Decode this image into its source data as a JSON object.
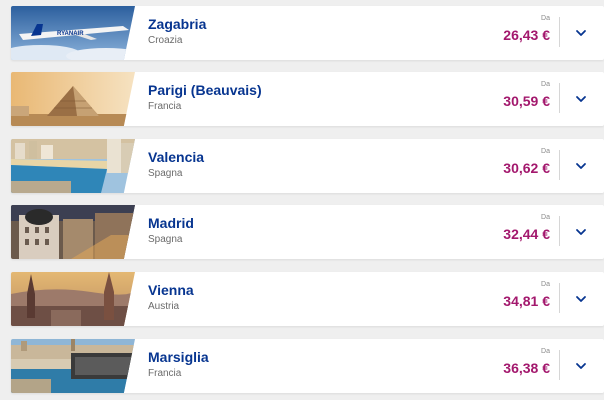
{
  "price_prefix": "Da",
  "colors": {
    "city": "#073590",
    "price": "#a3186d",
    "country": "#6b6b6b",
    "chevron": "#073590"
  },
  "destinations": [
    {
      "city": "Zagabria",
      "country": "Croazia",
      "price": "26,43 €",
      "image": "ryanair-plane"
    },
    {
      "city": "Parigi (Beauvais)",
      "country": "Francia",
      "price": "30,59 €",
      "image": "louvre-pyramid"
    },
    {
      "city": "Valencia",
      "country": "Spagna",
      "price": "30,62 €",
      "image": "valencia-beach"
    },
    {
      "city": "Madrid",
      "country": "Spagna",
      "price": "32,44 €",
      "image": "madrid-metropolis"
    },
    {
      "city": "Vienna",
      "country": "Austria",
      "price": "34,81 €",
      "image": "vienna-skyline"
    },
    {
      "city": "Marsiglia",
      "country": "Francia",
      "price": "36,38 €",
      "image": "marseille-harbour"
    }
  ]
}
